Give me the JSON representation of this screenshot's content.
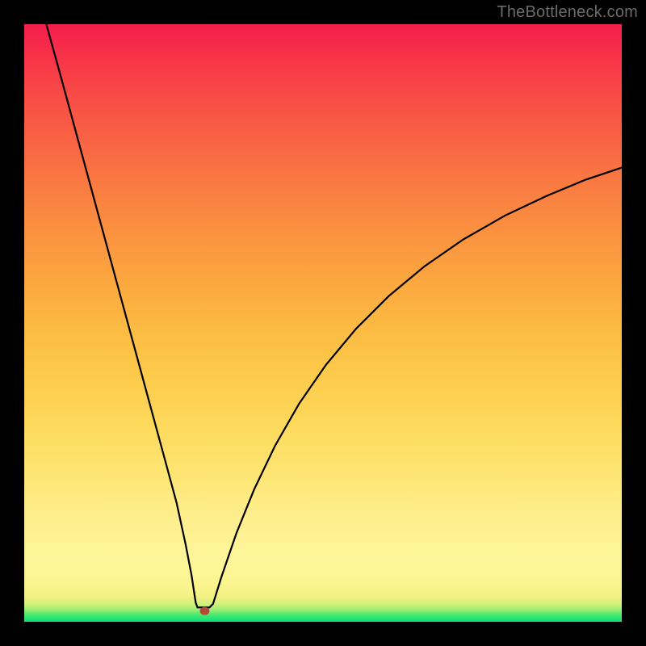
{
  "watermark": "TheBottleneck.com",
  "chart_data": {
    "type": "line",
    "title": "",
    "xlabel": "",
    "ylabel": "",
    "xlim": [
      0,
      1
    ],
    "ylim": [
      0,
      1
    ],
    "grid": false,
    "legend": false,
    "marker": {
      "x": 0.302,
      "y": 0.018,
      "color": "#b24a3a"
    },
    "curve_points": [
      {
        "x": 0.037,
        "y": 1.0
      },
      {
        "x": 0.06,
        "y": 0.917
      },
      {
        "x": 0.085,
        "y": 0.825
      },
      {
        "x": 0.11,
        "y": 0.733
      },
      {
        "x": 0.135,
        "y": 0.641
      },
      {
        "x": 0.16,
        "y": 0.549
      },
      {
        "x": 0.185,
        "y": 0.457
      },
      {
        "x": 0.21,
        "y": 0.365
      },
      {
        "x": 0.235,
        "y": 0.273
      },
      {
        "x": 0.255,
        "y": 0.199
      },
      {
        "x": 0.27,
        "y": 0.13
      },
      {
        "x": 0.28,
        "y": 0.078
      },
      {
        "x": 0.287,
        "y": 0.032
      },
      {
        "x": 0.29,
        "y": 0.024
      },
      {
        "x": 0.31,
        "y": 0.024
      },
      {
        "x": 0.316,
        "y": 0.03
      },
      {
        "x": 0.33,
        "y": 0.075
      },
      {
        "x": 0.355,
        "y": 0.148
      },
      {
        "x": 0.385,
        "y": 0.222
      },
      {
        "x": 0.42,
        "y": 0.295
      },
      {
        "x": 0.46,
        "y": 0.365
      },
      {
        "x": 0.505,
        "y": 0.43
      },
      {
        "x": 0.555,
        "y": 0.49
      },
      {
        "x": 0.61,
        "y": 0.545
      },
      {
        "x": 0.67,
        "y": 0.595
      },
      {
        "x": 0.735,
        "y": 0.64
      },
      {
        "x": 0.805,
        "y": 0.68
      },
      {
        "x": 0.875,
        "y": 0.713
      },
      {
        "x": 0.94,
        "y": 0.74
      },
      {
        "x": 1.0,
        "y": 0.76
      }
    ],
    "colors": {
      "curve": "#000000",
      "background_top": "#f51d4d",
      "background_bottom": "#05e27a",
      "frame": "#000000"
    }
  }
}
